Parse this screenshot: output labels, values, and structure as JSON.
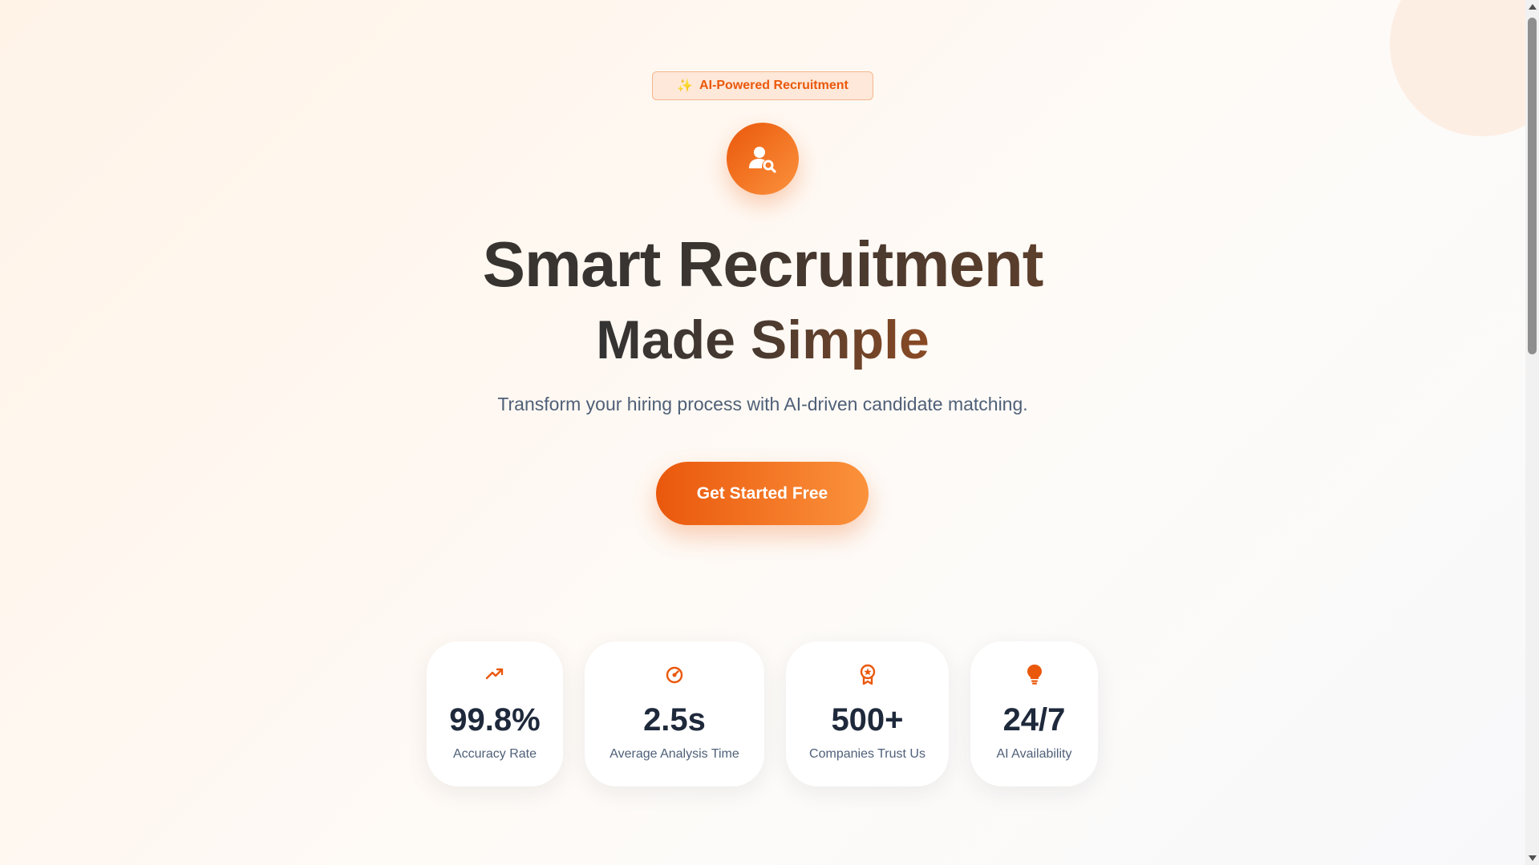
{
  "badge": {
    "icon": "sparkles-icon",
    "label": "AI-Powered Recruitment"
  },
  "hero": {
    "icon": "user-search-icon",
    "title_line1": "Smart Recruitment",
    "title_line2": "Made Simple",
    "subtitle": "Transform your hiring process with AI-driven candidate matching.",
    "cta_label": "Get Started Free"
  },
  "stats": [
    {
      "icon": "trending-up-icon",
      "value": "99.8%",
      "label": "Accuracy Rate"
    },
    {
      "icon": "gauge-icon",
      "value": "2.5s",
      "label": "Average Analysis Time"
    },
    {
      "icon": "award-icon",
      "value": "500+",
      "label": "Companies Trust Us"
    },
    {
      "icon": "lightbulb-icon",
      "value": "24/7",
      "label": "AI Availability"
    }
  ],
  "colors": {
    "accent": "#ea580c",
    "accent_light": "#fb923c",
    "text_dark": "#1e293b",
    "text_muted": "#4f6078"
  }
}
